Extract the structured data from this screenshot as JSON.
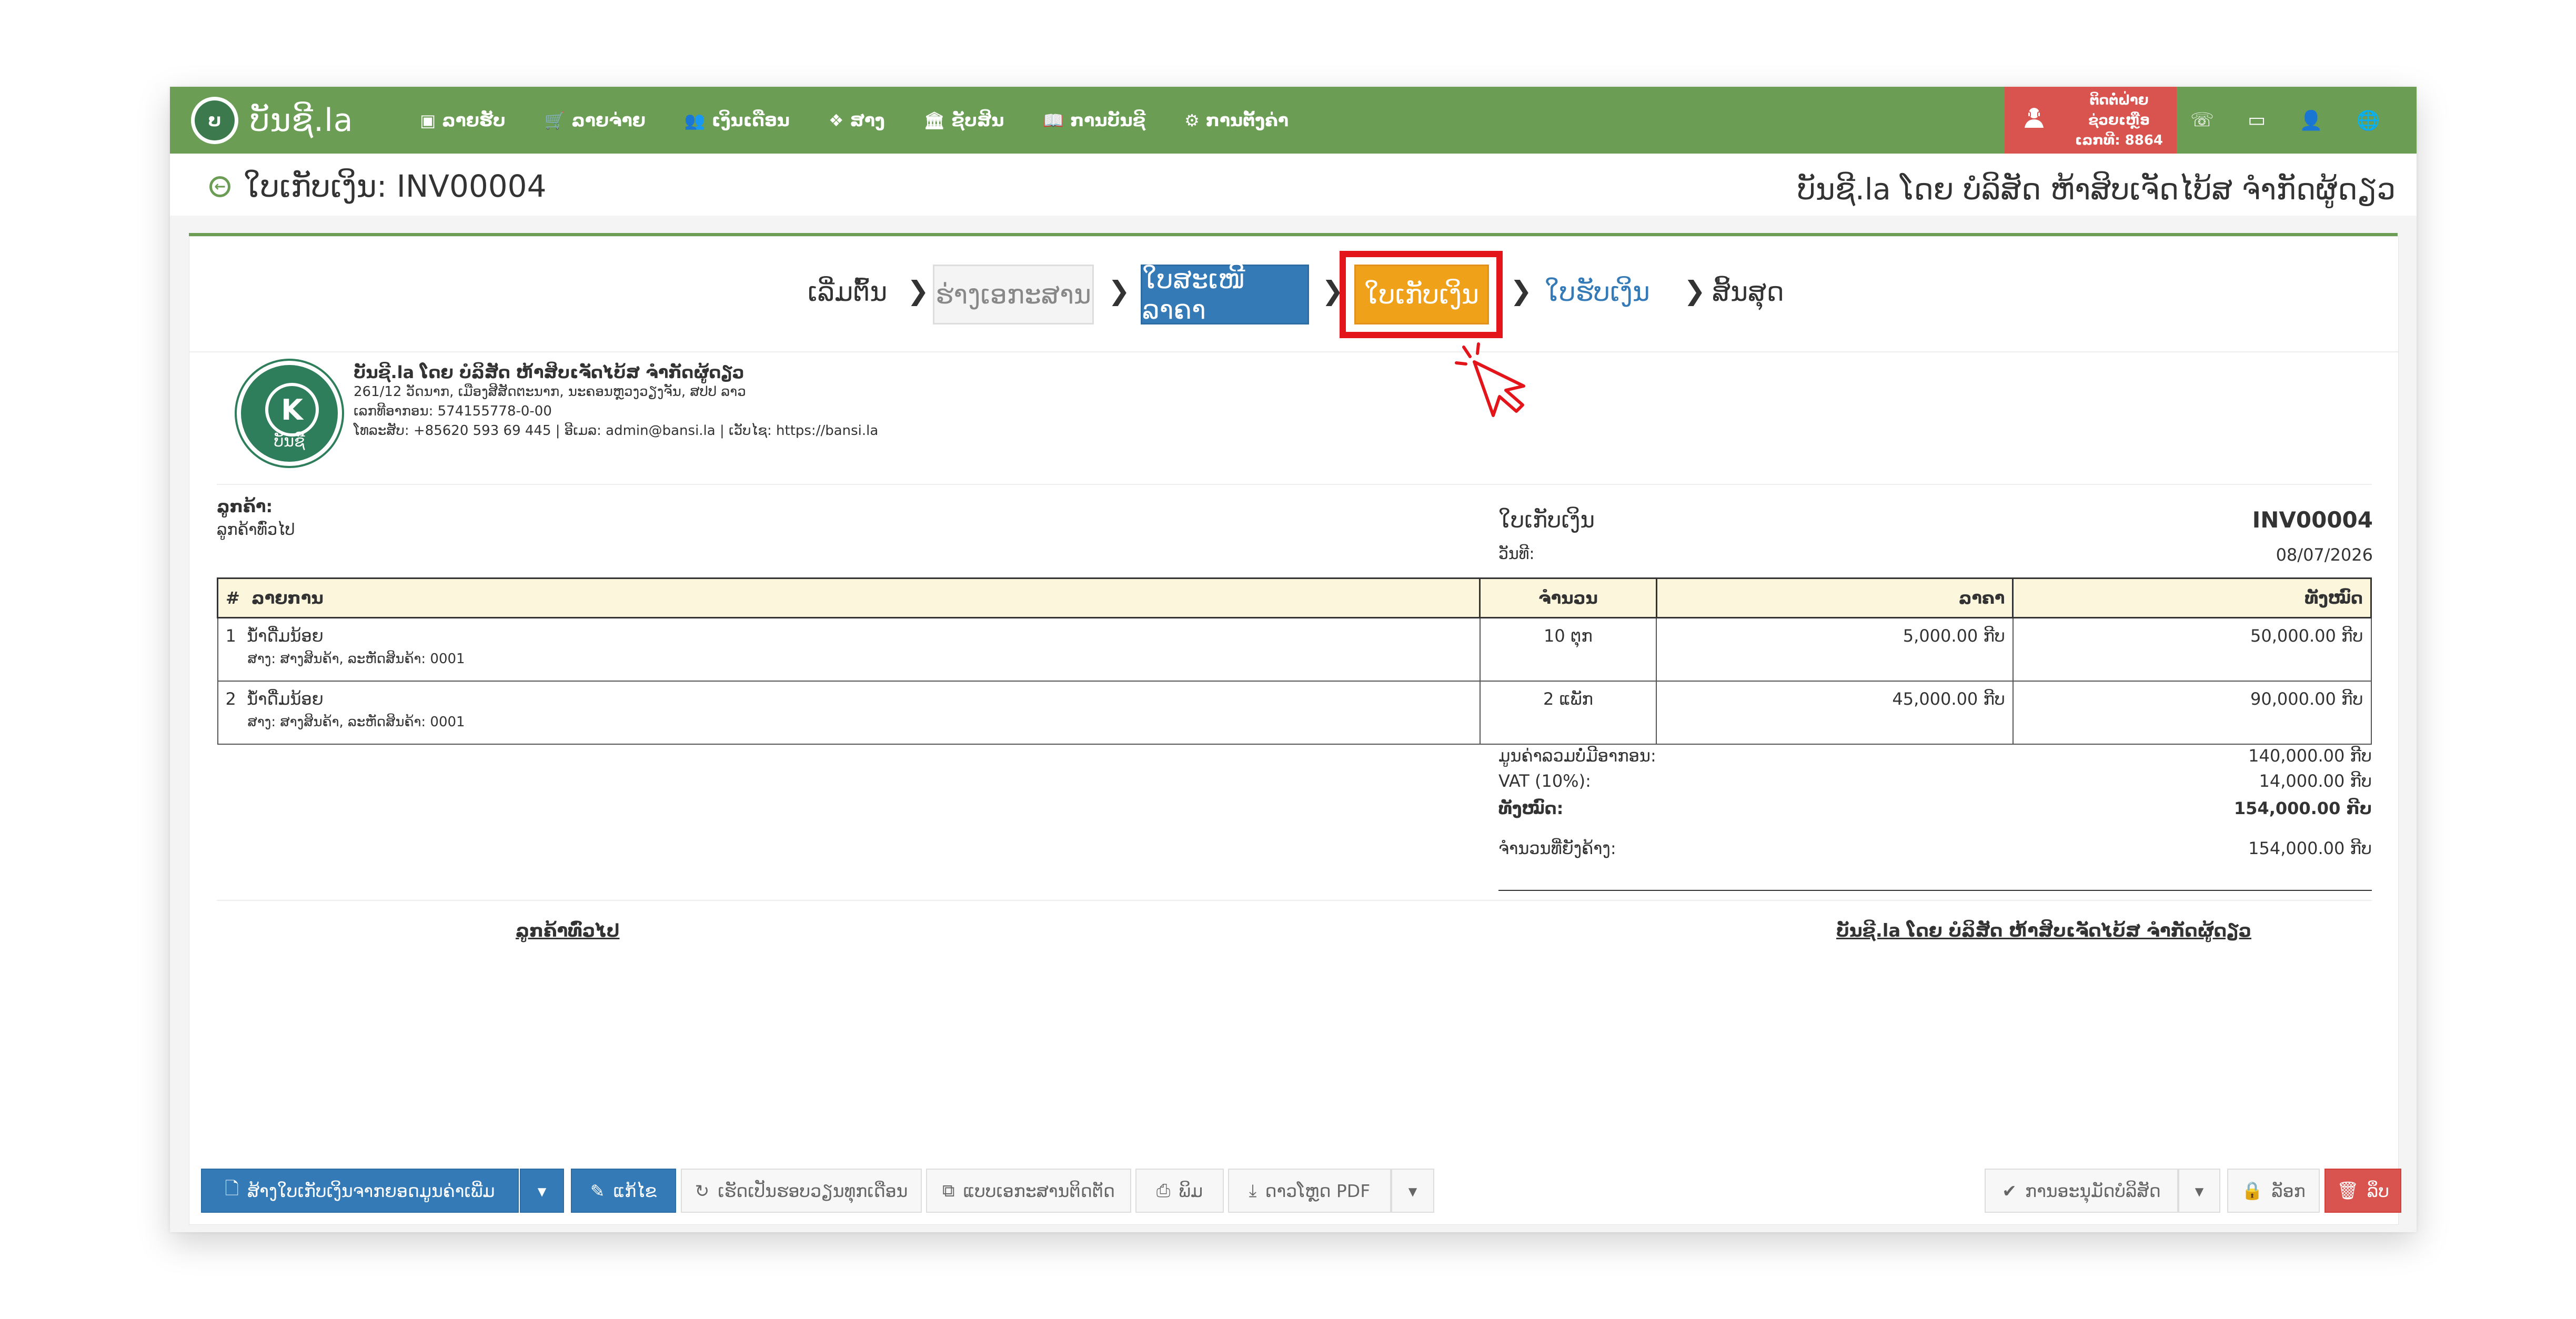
{
  "navbar": {
    "brand_logo_text": "ບ",
    "brand_name": "ບັນຊີ.la",
    "items": [
      {
        "icon": "▣",
        "icon_name": "money-icon",
        "label": "ລາຍຮັບ"
      },
      {
        "icon": "🛒",
        "icon_name": "cart-icon",
        "label": "ລາຍຈ່າຍ"
      },
      {
        "icon": "👥",
        "icon_name": "users-icon",
        "label": "ເງິນເດືອນ"
      },
      {
        "icon": "❖",
        "icon_name": "cubes-icon",
        "label": "ສາງ"
      },
      {
        "icon": "🏛",
        "icon_name": "bank-icon",
        "label": "ຊັບສິນ"
      },
      {
        "icon": "📖",
        "icon_name": "book-icon",
        "label": "ການບັນຊີ"
      },
      {
        "icon": "⚙",
        "icon_name": "gears-icon",
        "label": "ການຕັ້ງຄ່າ"
      }
    ],
    "support": {
      "line1": "ຕິດຕໍ່ຝ່າຍຊ່ວຍເຫຼືອ",
      "line2": "ເລກທີ: 8864"
    },
    "right_icons": [
      "☏",
      "▭",
      "👤",
      "🌐"
    ]
  },
  "title_bar": {
    "title": "ໃບເກັບເງິນ: INV00004",
    "company": "ບັນຊີ.la ໂດຍ ບໍລິສັດ ຫ້າສິບເຈັດໄບ້ສ ຈຳກັດຜູ້ດຽວ"
  },
  "steps": {
    "start": "ເລີ່ມຕົ້ນ",
    "draft": "ຮ່າງເອກະສານ",
    "quotation": "ໃບສະເໜີລາຄາ",
    "invoice": "ໃບເກັບເງິນ",
    "receipt": "ໃບຮັບເງິນ",
    "end": "ສິ້ນສຸດ",
    "chevron": "❯"
  },
  "company": {
    "seal_letter": "K",
    "seal_name": "ບັນຊີ",
    "name": "ບັນຊີ.la ໂດຍ ບໍລິສັດ ຫ້າສິບເຈັດໄບ້ສ ຈຳກັດຜູ້ດຽວ",
    "address": "261/12 ວັດນາກ, ເມືອງສີສັດຕະນາກ, ນະຄອນຫຼວງວຽງຈັນ, ສປປ ລາວ",
    "tax_id": "ເລກທີອາກອນ: 574155778-0-00",
    "contact": "ໂທລະສັບ: +85620 593 69 445 | ອີເມລ: admin@bansi.la | ເວັບໄຊ: https://bansi.la"
  },
  "customer": {
    "label": "ລູກຄ້າ:",
    "name": "ລູກຄ້າທົ່ວໄປ"
  },
  "document": {
    "type": "ໃບເກັບເງິນ",
    "number": "INV00004",
    "date_label": "ວັນທີ:",
    "date": "08/07/2026"
  },
  "table": {
    "headers": {
      "no": "#",
      "item": "ລາຍການ",
      "qty": "ຈຳນວນ",
      "price": "ລາຄາ",
      "total": "ທັງໝົດ"
    },
    "rows": [
      {
        "no": "1",
        "name": "ນ້ຳດື່ມນ້ອຍ",
        "sub": "ສາງ: ສາງສິນຄ້າ, ລະຫັດສິນຄ້າ: 0001",
        "qty": "10 ຕຸກ",
        "price": "5,000.00 ກີບ",
        "total": "50,000.00 ກີບ"
      },
      {
        "no": "2",
        "name": "ນ້ຳດື່ມນ້ອຍ",
        "sub": "ສາງ: ສາງສິນຄ້າ, ລະຫັດສິນຄ້າ: 0001",
        "qty": "2 ແພັກ",
        "price": "45,000.00 ກີບ",
        "total": "90,000.00 ກີບ"
      }
    ]
  },
  "totals": {
    "subtotal_label": "ມູນຄ່າລວມບໍ່ມີອາກອນ:",
    "subtotal": "140,000.00 ກີບ",
    "vat_label": "VAT (10%):",
    "vat": "14,000.00 ກີບ",
    "total_label": "ທັງໝົດ:",
    "total": "154,000.00 ກີບ",
    "outstanding_label": "ຈຳນວນທີ່ຍັງຄ້າງ:",
    "outstanding": "154,000.00 ກີບ"
  },
  "signatures": {
    "customer": "ລູກຄ້າທົ່ວໄປ",
    "company": "ບັນຊີ.la ໂດຍ ບໍລິສັດ ຫ້າສິບເຈັດໄບ້ສ ຈຳກັດຜູ້ດຽວ"
  },
  "toolbar": {
    "create_receipt": "ສ້າງໃບເກັບເງິນຈາກຍອດມູນຄ່າເພີ່ມ",
    "edit": "ແກ້ໄຂ",
    "recurring": "ເຮັດເປັນຮອບວຽນທຸກເດືອນ",
    "copy": "ແບບເອກະສານຕິດຕັດ",
    "print": "ພິມ",
    "pdf": "ດາວໂຫຼດ PDF",
    "approve": "ການອະນຸມັດບໍລິສັດ",
    "lock": "ລັອກ",
    "delete": "ລຶບ",
    "caret": "▾"
  }
}
